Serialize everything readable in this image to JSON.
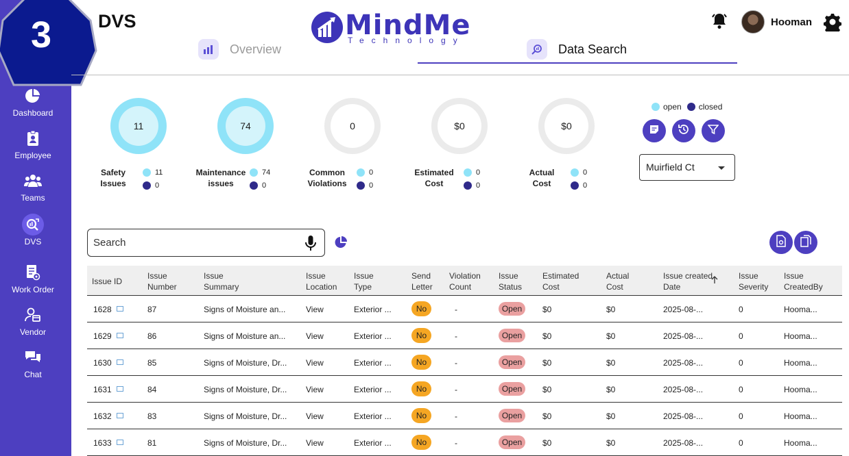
{
  "step": "3",
  "page_title": "DVS",
  "logo": {
    "name": "MindMe",
    "sub": "Technology"
  },
  "user": {
    "name": "Hooman"
  },
  "tabs": [
    {
      "label": "Overview"
    },
    {
      "label": "Data Search"
    }
  ],
  "sidebar": {
    "items": [
      {
        "label": "Dashboard",
        "icon": "pie-chart-icon"
      },
      {
        "label": "Employee",
        "icon": "clipboard-person-icon"
      },
      {
        "label": "Teams",
        "icon": "group-icon"
      },
      {
        "label": "DVS",
        "icon": "search-data-icon"
      },
      {
        "label": "Work Order",
        "icon": "work-order-icon"
      },
      {
        "label": "Vendor",
        "icon": "vendor-icon"
      },
      {
        "label": "Chat",
        "icon": "chat-icon"
      }
    ]
  },
  "stats": [
    {
      "value": "11",
      "label1": "Safety",
      "label2": "Issues",
      "open": "11",
      "closed": "0",
      "filled": true
    },
    {
      "value": "74",
      "label1": "Maintenance",
      "label2": "issues",
      "open": "74",
      "closed": "0",
      "filled": true
    },
    {
      "value": "0",
      "label1": "Common",
      "label2": "Violations",
      "open": "0",
      "closed": "0",
      "filled": false
    },
    {
      "value": "$0",
      "label1": "Estimated",
      "label2": "Cost",
      "open": "0",
      "closed": "0",
      "filled": false
    },
    {
      "value": "$0",
      "label1": "Actual",
      "label2": "Cost",
      "open": "0",
      "closed": "0",
      "filled": false
    }
  ],
  "legend": {
    "open": "open",
    "closed": "closed"
  },
  "colors": {
    "accent": "#4d3fc0",
    "open": "#8fe3f8",
    "closed": "#2f2a8a",
    "no_pill": "#f5a623",
    "open_pill": "#eaa0a0"
  },
  "property_select": {
    "value": "Muirfield Ct"
  },
  "search": {
    "placeholder": "Search"
  },
  "table": {
    "headers": [
      [
        "Issue ID",
        ""
      ],
      [
        "Issue",
        "Number"
      ],
      [
        "Issue",
        "Summary"
      ],
      [
        "Issue",
        "Location"
      ],
      [
        "Issue",
        "Type"
      ],
      [
        "Send",
        "Letter"
      ],
      [
        "Violation",
        "Count"
      ],
      [
        "Issue",
        "Status"
      ],
      [
        "Estimated",
        "Cost"
      ],
      [
        "Actual",
        "Cost"
      ],
      [
        "Issue created",
        "Date"
      ],
      [
        "Issue",
        "Severity"
      ],
      [
        "Issue",
        "CreatedBy"
      ]
    ],
    "rows": [
      {
        "id": "1628",
        "number": "87",
        "summary": "Signs of Moisture an...",
        "location": "View",
        "type": "Exterior ...",
        "letter": "No",
        "violations": "-",
        "status": "Open",
        "est": "$0",
        "actual": "$0",
        "date": "2025-08-...",
        "severity": "0",
        "by": "Hooma..."
      },
      {
        "id": "1629",
        "number": "86",
        "summary": "Signs of Moisture an...",
        "location": "View",
        "type": "Exterior ...",
        "letter": "No",
        "violations": "-",
        "status": "Open",
        "est": "$0",
        "actual": "$0",
        "date": "2025-08-...",
        "severity": "0",
        "by": "Hooma..."
      },
      {
        "id": "1630",
        "number": "85",
        "summary": "Signs of Moisture, Dr...",
        "location": "View",
        "type": "Exterior ...",
        "letter": "No",
        "violations": "-",
        "status": "Open",
        "est": "$0",
        "actual": "$0",
        "date": "2025-08-...",
        "severity": "0",
        "by": "Hooma..."
      },
      {
        "id": "1631",
        "number": "84",
        "summary": "Signs of Moisture, Dr...",
        "location": "View",
        "type": "Exterior ...",
        "letter": "No",
        "violations": "-",
        "status": "Open",
        "est": "$0",
        "actual": "$0",
        "date": "2025-08-...",
        "severity": "0",
        "by": "Hooma..."
      },
      {
        "id": "1632",
        "number": "83",
        "summary": "Signs of Moisture, Dr...",
        "location": "View",
        "type": "Exterior ...",
        "letter": "No",
        "violations": "-",
        "status": "Open",
        "est": "$0",
        "actual": "$0",
        "date": "2025-08-...",
        "severity": "0",
        "by": "Hooma..."
      },
      {
        "id": "1633",
        "number": "81",
        "summary": "Signs of Moisture, Dr...",
        "location": "View",
        "type": "Exterior ...",
        "letter": "No",
        "violations": "-",
        "status": "Open",
        "est": "$0",
        "actual": "$0",
        "date": "2025-08-...",
        "severity": "0",
        "by": "Hooma..."
      }
    ]
  }
}
